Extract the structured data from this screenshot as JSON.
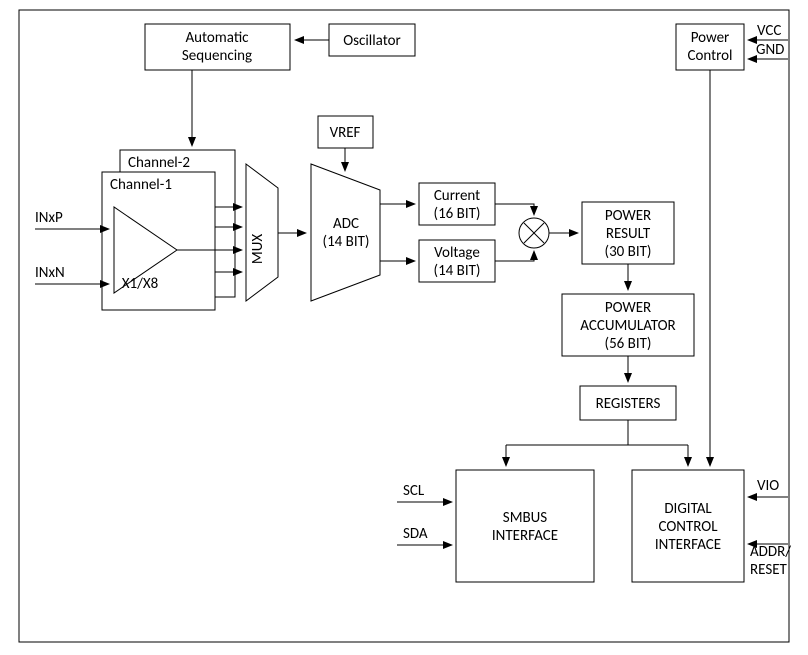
{
  "blocks": {
    "auto_seq1": "Automatic",
    "auto_seq2": "Sequencing",
    "oscillator": "Oscillator",
    "channel2": "Channel-2",
    "channel1": "Channel-1",
    "gain": "X1/X8",
    "mux": "MUX",
    "adc1": "ADC",
    "adc2": "(14 BIT)",
    "vref": "VREF",
    "current1": "Current",
    "current2": "(16 BIT)",
    "voltage1": "Voltage",
    "voltage2": "(14 BIT)",
    "power_res1": "POWER",
    "power_res2": "RESULT",
    "power_res3": "(30 BIT)",
    "power_acc1": "POWER",
    "power_acc2": "ACCUMULATOR",
    "power_acc3": "(56 BIT)",
    "registers": "REGISTERS",
    "smbus1": "SMBUS",
    "smbus2": "INTERFACE",
    "digctl1": "DIGITAL",
    "digctl2": "CONTROL",
    "digctl3": "INTERFACE",
    "powerctl1": "Power",
    "powerctl2": "Control"
  },
  "pins": {
    "inxp": "INxP",
    "inxn": "INxN",
    "scl": "SCL",
    "sda": "SDA",
    "vcc": "VCC",
    "gnd": "GND",
    "vio": "VIO",
    "addr1": "ADDR/",
    "addr2": "RESET"
  }
}
